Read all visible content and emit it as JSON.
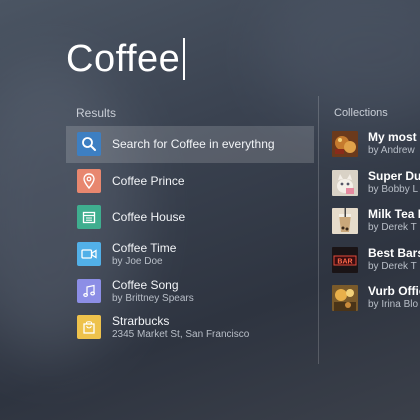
{
  "search": {
    "query": "Coffee"
  },
  "results": {
    "label": "Results",
    "items": [
      {
        "title": "Search for Coffee in everythng",
        "subtitle": "",
        "icon": "search-icon",
        "color": "#3d7fc2",
        "selected": true
      },
      {
        "title": "Coffee Prince",
        "subtitle": "",
        "icon": "location-pin-icon",
        "color": "#e8876f",
        "selected": false
      },
      {
        "title": "Coffee House",
        "subtitle": "",
        "icon": "calendar-icon",
        "color": "#3fae8f",
        "selected": false
      },
      {
        "title": "Coffee Time",
        "subtitle": "by Joe Doe",
        "icon": "video-icon",
        "color": "#52b0e8",
        "selected": false
      },
      {
        "title": "Coffee Song",
        "subtitle": "by Brittney Spears",
        "icon": "music-icon",
        "color": "#8c8ee6",
        "selected": false
      },
      {
        "title": "Strarbucks",
        "subtitle": "2345 Market St, San Francisco",
        "icon": "shopping-bag-icon",
        "color": "#eec24c",
        "selected": false
      }
    ]
  },
  "collections": {
    "label": "Collections",
    "items": [
      {
        "title": "My most f",
        "subtitle": "by Andrew",
        "thumb": "food-photo"
      },
      {
        "title": "Super Dup",
        "subtitle": "by Bobby L",
        "thumb": "kitten-photo"
      },
      {
        "title": "Milk Tea F",
        "subtitle": "by Derek T",
        "thumb": "milk-tea-photo"
      },
      {
        "title": "Best Bars",
        "subtitle": "by Derek T",
        "thumb": "bar-sign-photo"
      },
      {
        "title": "Vurb Offic",
        "subtitle": "by Irina Blo",
        "thumb": "office-photo"
      }
    ]
  }
}
